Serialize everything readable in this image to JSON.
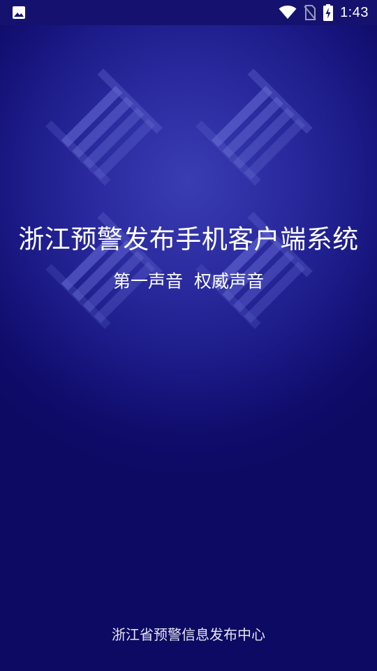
{
  "status_bar": {
    "time": "1:43",
    "icons": [
      "gallery-icon",
      "wifi-icon",
      "no-sim-icon",
      "battery-charging-icon"
    ]
  },
  "splash": {
    "title": "浙江预警发布手机客户端系统",
    "slogan": "第一声音  权威声音",
    "footer": "浙江省预警信息发布中心"
  },
  "colors": {
    "background_center": "#3a3cb2",
    "background_edge": "#0d0a63",
    "status_bar": "#14126e",
    "text": "#ffffff"
  }
}
